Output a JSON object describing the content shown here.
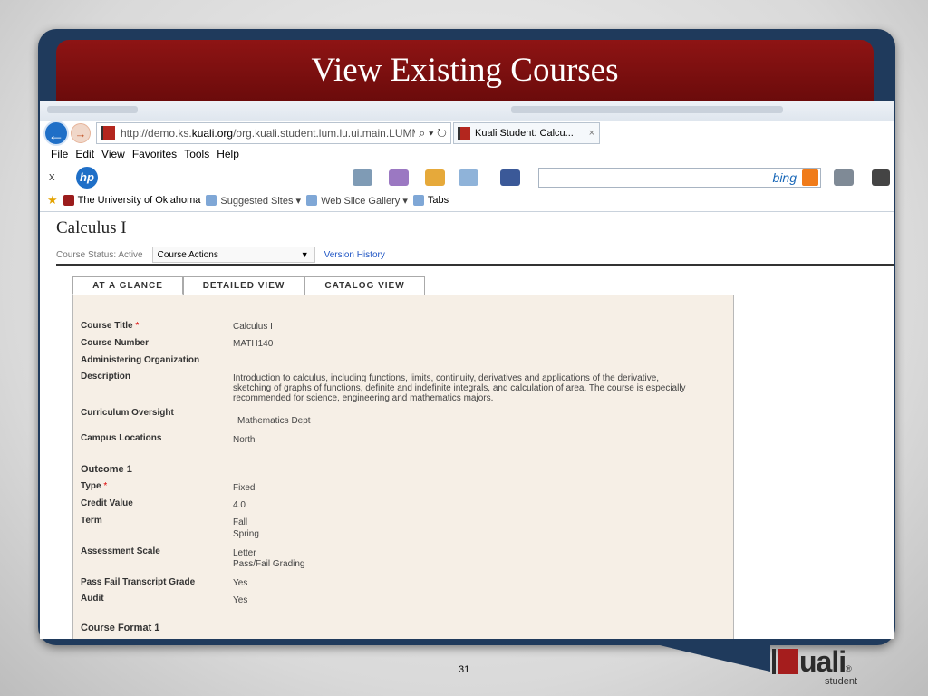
{
  "slide": {
    "title": "View Existing Courses",
    "page_number": "31"
  },
  "browser": {
    "url_host": "http://demo.ks.",
    "url_domain": "kuali.org",
    "url_path": "/org.kuali.student.lum.lu.ui.main.LUMMain,",
    "url_tools": "⌕ ▾ ↻",
    "tab_title": "Kuali Student: Calcu...",
    "menu": [
      "File",
      "Edit",
      "View",
      "Favorites",
      "Tools",
      "Help"
    ],
    "search_brand": "bing",
    "favorites": {
      "university": "The University of Oklahoma",
      "suggested": "Suggested Sites ▾",
      "web_slice": "Web Slice Gallery ▾",
      "tabs": "Tabs"
    },
    "close_glyph": "x",
    "hp_logo": "hp"
  },
  "page": {
    "title": "Calculus I",
    "status_label": "Course Status: Active",
    "actions_select": "Course Actions",
    "version_history": "Version History",
    "tabs": [
      {
        "label": "AT A GLANCE",
        "active": true
      },
      {
        "label": "DETAILED VIEW",
        "active": false
      },
      {
        "label": "CATALOG VIEW",
        "active": false
      }
    ],
    "fields": {
      "course_title_label": "Course Title",
      "course_title": "Calculus I",
      "course_number_label": "Course Number",
      "course_number": "MATH140",
      "admin_org_label": "Administering Organization",
      "description_label": "Description",
      "description_line1": "Introduction to calculus, including functions, limits, continuity, derivatives and applications of the derivative,",
      "description_line2": "sketching of graphs of functions, definite and indefinite integrals, and calculation of area. The course is especially",
      "description_line3": "recommended for science, engineering and mathematics majors.",
      "curriculum_label": "Curriculum Oversight",
      "curriculum": "Mathematics Dept",
      "campus_label": "Campus Locations",
      "campus": "North"
    },
    "outcome": {
      "heading": "Outcome 1",
      "type_label": "Type",
      "type": "Fixed",
      "credit_label": "Credit Value",
      "credit": "4.0",
      "term_label": "Term",
      "term_1": "Fall",
      "term_2": "Spring",
      "assessment_label": "Assessment Scale",
      "assessment_1": "Letter",
      "assessment_2": "Pass/Fail Grading",
      "passfail_label": "Pass Fail Transcript Grade",
      "passfail": "Yes",
      "audit_label": "Audit",
      "audit": "Yes"
    },
    "format_heading": "Course Format 1",
    "required_marker": "*"
  },
  "brand": {
    "word": "uali",
    "sub": "student",
    "reg": "®"
  },
  "colors": {
    "frame": "#1f3a5c",
    "title_bar": "#8e1414",
    "panel_bg": "#f6efe6",
    "link": "#1f55c4",
    "brand_red": "#a51d1d"
  }
}
